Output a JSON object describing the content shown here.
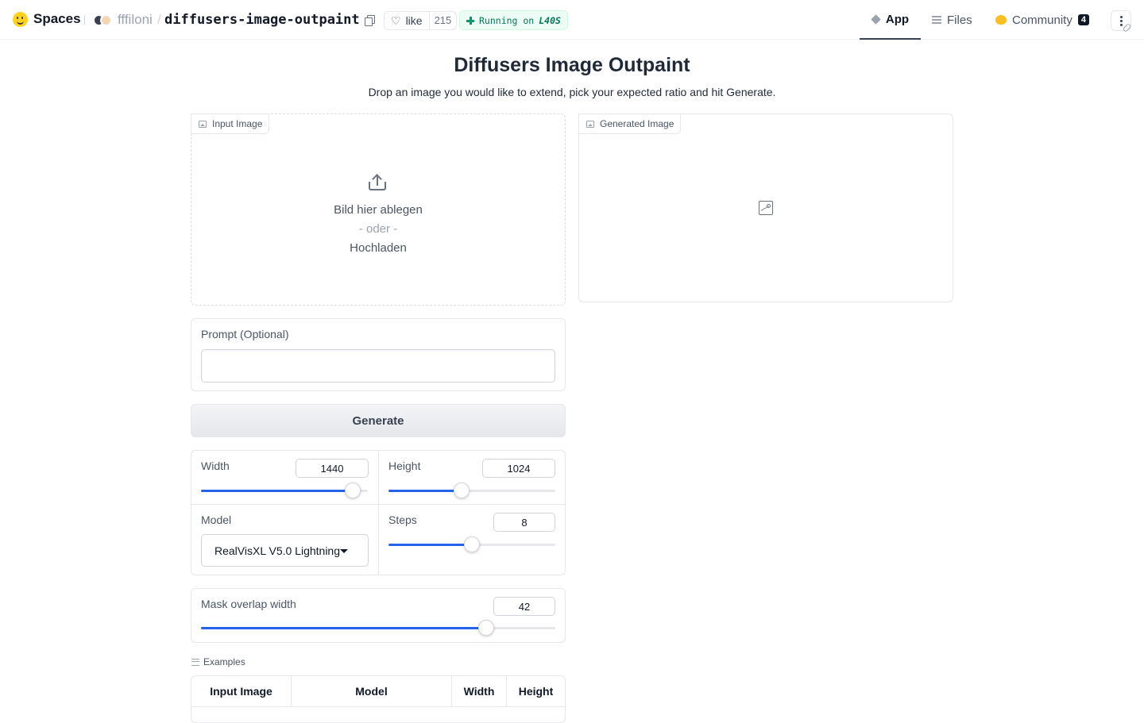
{
  "header": {
    "brand": "Spaces",
    "owner": "fffiloni",
    "separator": "/",
    "repo": "diffusers-image-outpaint",
    "like_label": "like",
    "like_count": "215",
    "status_text": "Running on",
    "status_hardware": "L40S",
    "tabs": [
      {
        "label": "App",
        "icon": "cube-icon",
        "active": true
      },
      {
        "label": "Files",
        "icon": "files-icon",
        "active": false
      },
      {
        "label": "Community",
        "icon": "community-icon",
        "badge": "4",
        "active": false
      }
    ]
  },
  "main": {
    "title": "Diffusers Image Outpaint",
    "subtitle": "Drop an image you would like to extend, pick your expected ratio and hit Generate.",
    "input_image": {
      "label": "Input Image",
      "drop_text": "Bild hier ablegen",
      "or_text": "- oder -",
      "upload_text": "Hochladen"
    },
    "generated_image": {
      "label": "Generated Image"
    },
    "prompt": {
      "label": "Prompt (Optional)",
      "value": ""
    },
    "generate_label": "Generate",
    "width": {
      "label": "Width",
      "value": "1440",
      "fraction": 0.95
    },
    "height": {
      "label": "Height",
      "value": "1024",
      "fraction": 0.43
    },
    "model": {
      "label": "Model",
      "selected": "RealVisXL V5.0 Lightning"
    },
    "steps": {
      "label": "Steps",
      "value": "8",
      "fraction": 0.5
    },
    "mask_overlap": {
      "label": "Mask overlap width",
      "value": "42",
      "fraction": 0.82
    },
    "examples": {
      "label": "Examples",
      "columns": [
        "Input Image",
        "Model",
        "Width",
        "Height"
      ]
    }
  },
  "colors": {
    "accent": "#2563eb",
    "status_bg": "#ecfdf5",
    "status_text": "#047857"
  }
}
